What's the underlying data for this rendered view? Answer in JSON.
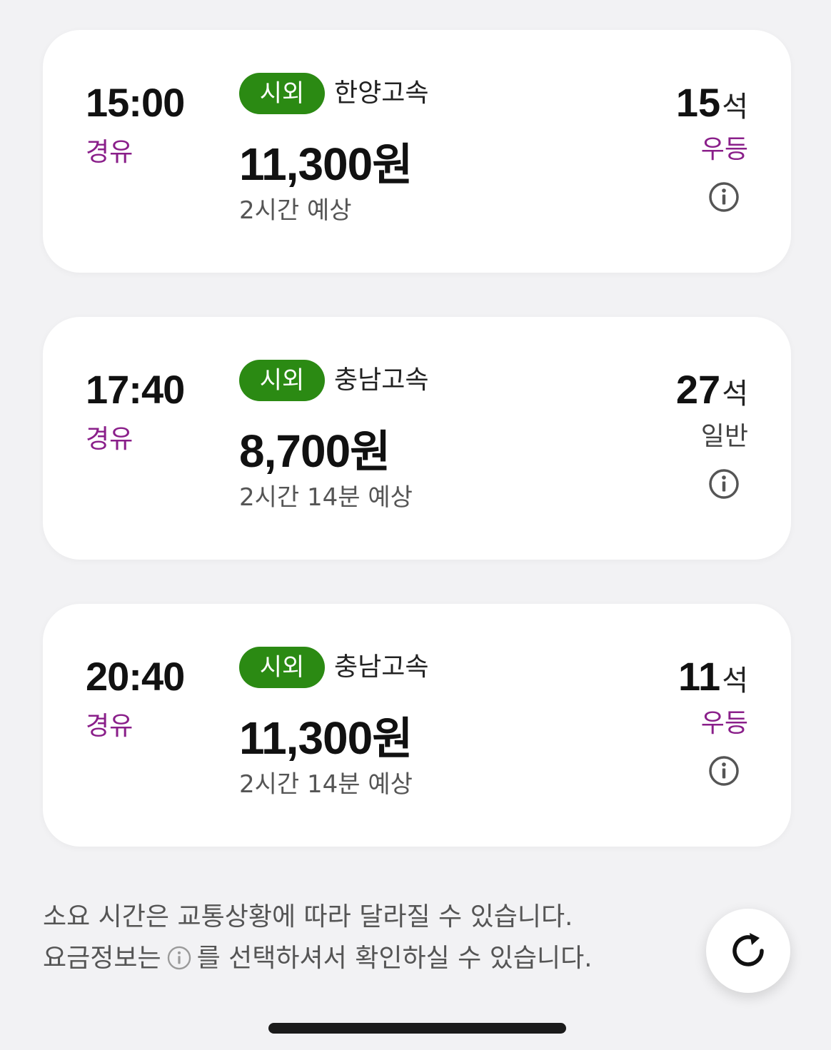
{
  "colors": {
    "background": "#f2f2f4",
    "card": "#ffffff",
    "badge_green": "#2b8a13",
    "route_purple": "#8a1f8a",
    "premium_grade": "#8a1f8a",
    "normal_grade": "#444444"
  },
  "schedules": [
    {
      "time": "15:00",
      "route_type": "경유",
      "badge": "시외",
      "company": "한양고속",
      "price": "11,300",
      "price_unit": "원",
      "duration": "2시간 예상",
      "seats": "15",
      "seats_unit": "석",
      "grade": "우등",
      "grade_color": "#8a1f8a",
      "info_icon": "info-icon"
    },
    {
      "time": "17:40",
      "route_type": "경유",
      "badge": "시외",
      "company": "충남고속",
      "price": "8,700",
      "price_unit": "원",
      "duration": "2시간 14분 예상",
      "seats": "27",
      "seats_unit": "석",
      "grade": "일반",
      "grade_color": "#444444",
      "info_icon": "info-icon"
    },
    {
      "time": "20:40",
      "route_type": "경유",
      "badge": "시외",
      "company": "충남고속",
      "price": "11,300",
      "price_unit": "원",
      "duration": "2시간 14분 예상",
      "seats": "11",
      "seats_unit": "석",
      "grade": "우등",
      "grade_color": "#8a1f8a",
      "info_icon": "info-icon"
    }
  ],
  "notice": {
    "line1": "소요 시간은 교통상황에 따라 달라질 수 있습니다.",
    "line2_before": "요금정보는",
    "line2_after": "를 선택하셔서 확인하실 수 있습니다."
  },
  "refresh_button": {
    "icon": "refresh-icon"
  }
}
